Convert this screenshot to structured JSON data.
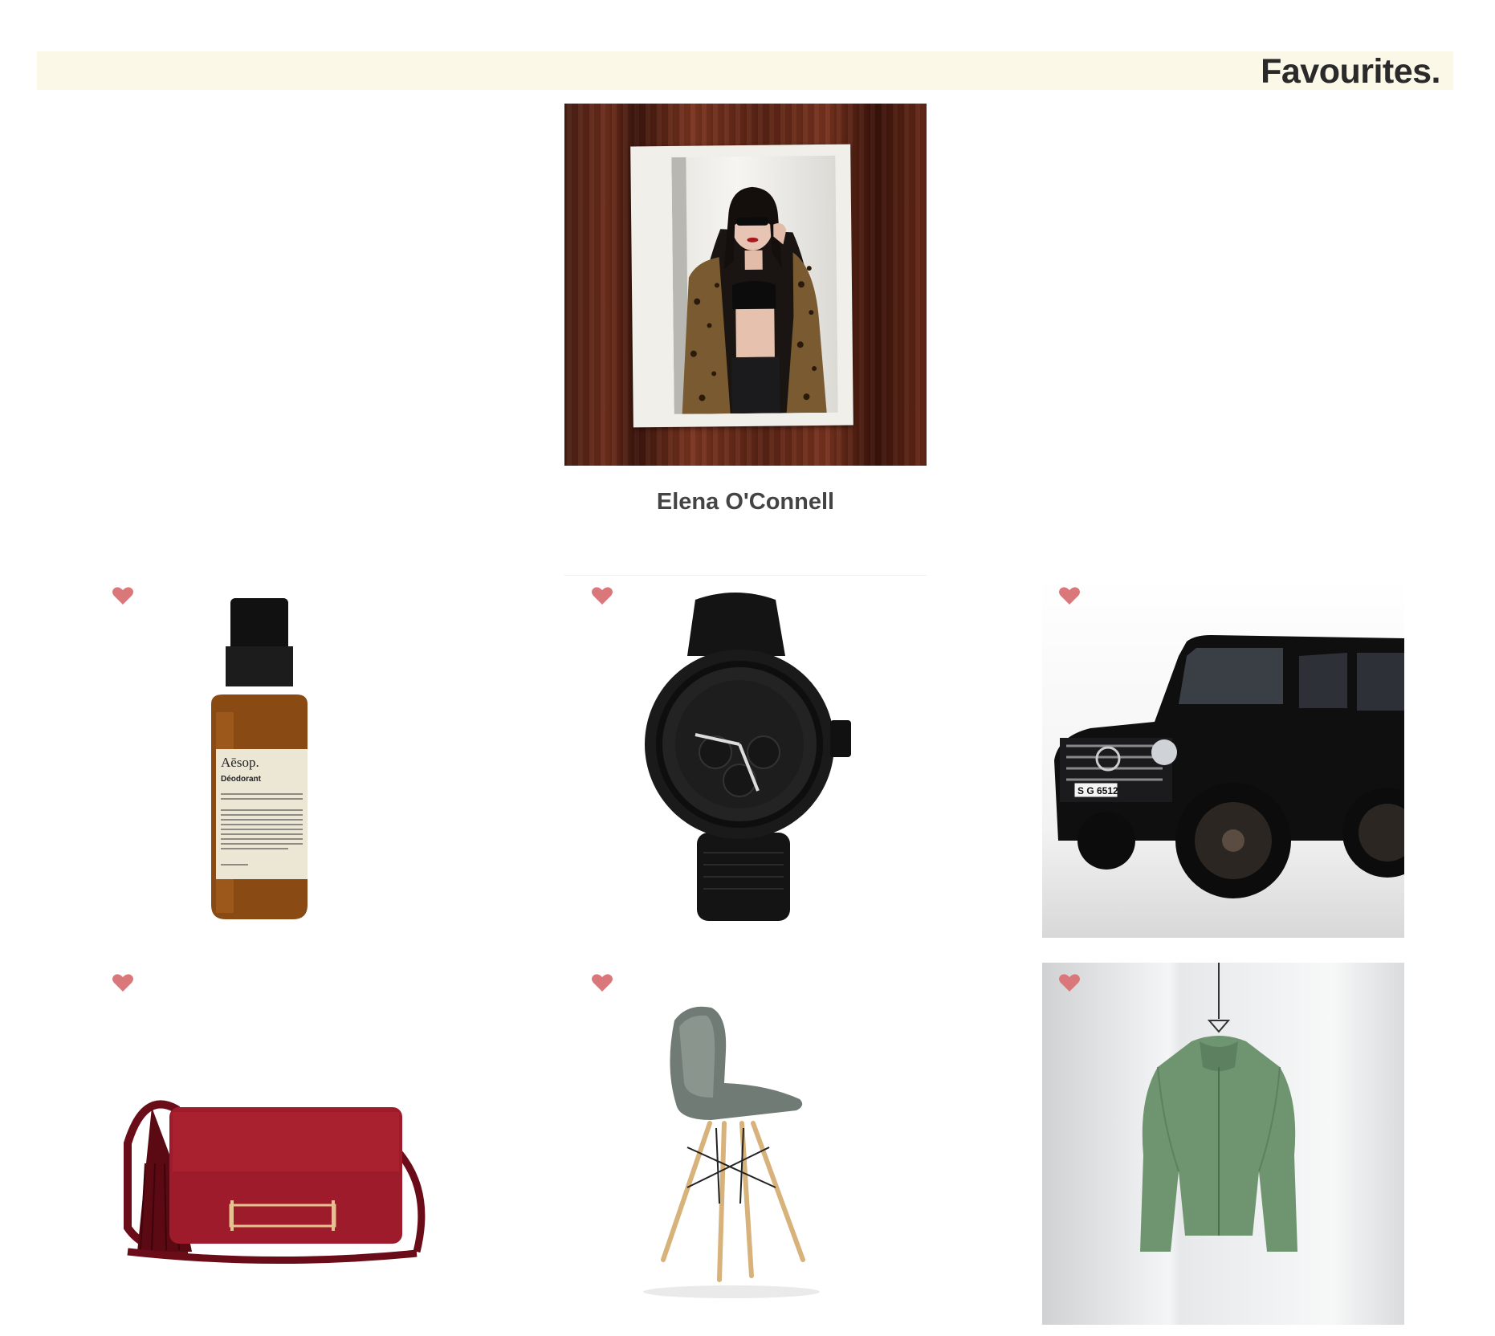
{
  "header": {
    "title": "Favourites."
  },
  "profile": {
    "name": "Elena O'Connell"
  },
  "favourites": [
    {
      "item": "Aesop Deodorant",
      "brand_text": "Aēsop.",
      "product_text": "Déodorant",
      "favourited": true
    },
    {
      "item": "Black dive chronograph watch",
      "favourited": true
    },
    {
      "item": "Black G-Class SUV",
      "plate_text": "S G 6512",
      "favourited": true
    },
    {
      "item": "Red leather tassel bag",
      "favourited": true
    },
    {
      "item": "Grey Eames shell chair",
      "favourited": true
    },
    {
      "item": "Green hanging jacket",
      "favourited": true
    }
  ],
  "colors": {
    "header_bg": "#fbf8e8",
    "heart": "#d9777b",
    "title": "#2a2a2a",
    "name": "#444444"
  },
  "icons": {
    "favourite": "heart-icon"
  }
}
